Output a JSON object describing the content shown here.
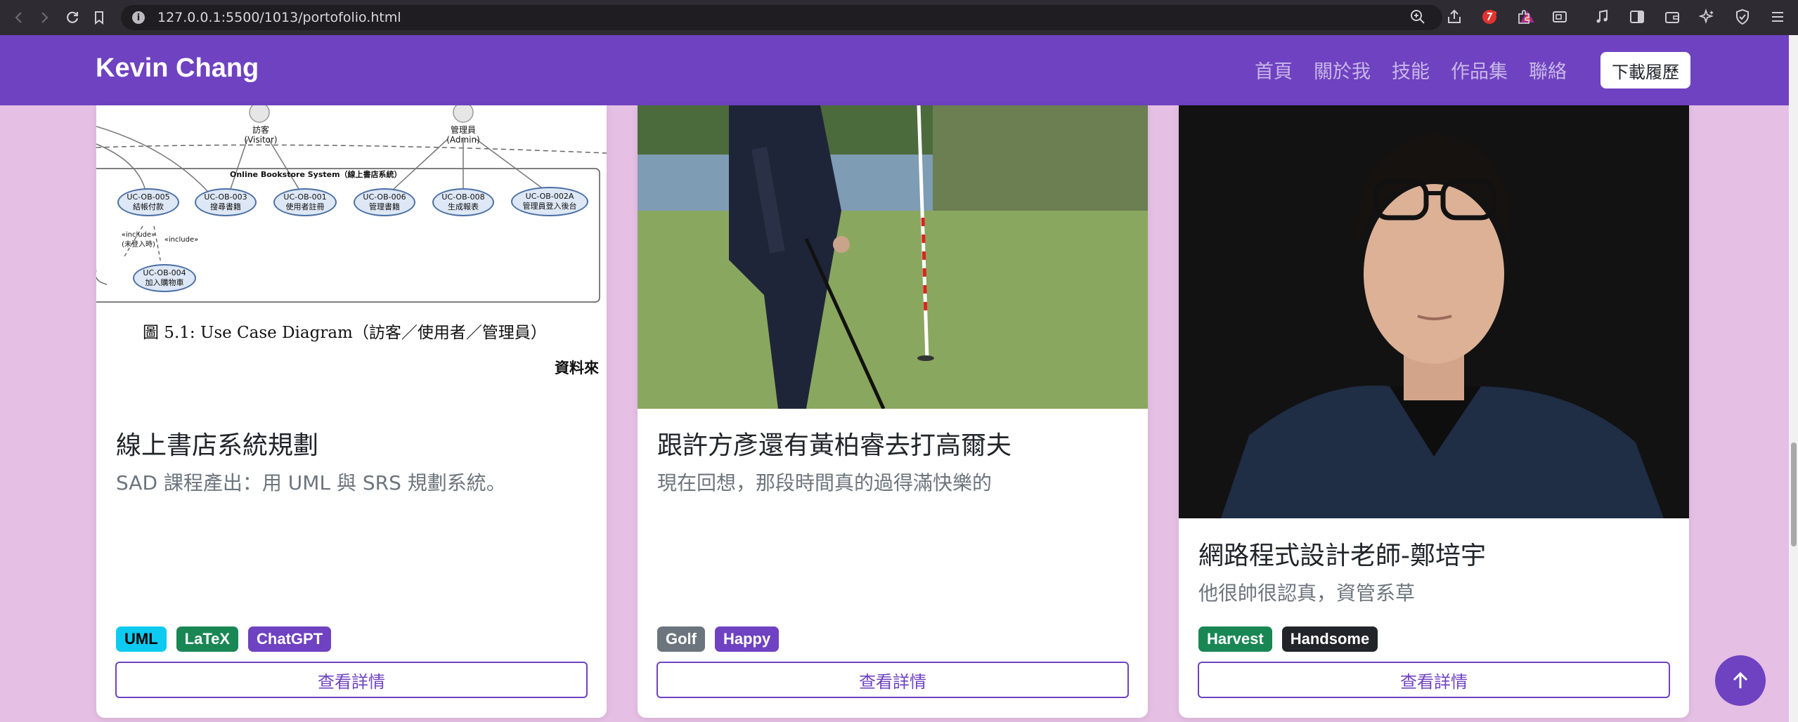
{
  "browser": {
    "url": "127.0.0.1:5500/1013/portofolio.html"
  },
  "navbar": {
    "brand": "Kevin Chang",
    "links": [
      "首頁",
      "關於我",
      "技能",
      "作品集",
      "聯絡"
    ],
    "resume_button": "下載履歷"
  },
  "cards": [
    {
      "title": "線上書店系統規劃",
      "text": "SAD 課程產出：用 UML 與 SRS 規劃系統。",
      "tags": [
        {
          "label": "UML",
          "color": "#0dcaf0",
          "text_color": "#000000"
        },
        {
          "label": "LaTeX",
          "color": "#198754",
          "text_color": "#ffffff"
        },
        {
          "label": "ChatGPT",
          "color": "#6f42c1",
          "text_color": "#ffffff"
        }
      ],
      "button": "查看詳情",
      "diagram": {
        "actors": [
          "訪客\n(Visitor)",
          "管理員\n(Admin)"
        ],
        "system_label": "Online Bookstore System（線上書店系統）",
        "use_cases": [
          "UC-OB-005\n結帳付款",
          "UC-OB-003\n搜尋書籍",
          "UC-OB-001\n使用者註冊",
          "UC-OB-006\n管理書籍",
          "UC-OB-008\n生成報表",
          "UC-OB-002A\n管理員登入後台",
          "UC-OB-004\n加入購物車"
        ],
        "include_labels": [
          "«include»\n(未登入時)",
          "«include»"
        ],
        "caption": "圖 5.1: Use Case Diagram（訪客／使用者／管理員）",
        "source_text": "資料來"
      }
    },
    {
      "title": "跟許方彥還有黃柏睿去打高爾夫",
      "text": "現在回想，那段時間真的過得滿快樂的",
      "tags": [
        {
          "label": "Golf",
          "color": "#6c757d",
          "text_color": "#ffffff"
        },
        {
          "label": "Happy",
          "color": "#6f42c1",
          "text_color": "#ffffff"
        }
      ],
      "button": "查看詳情"
    },
    {
      "title": "網路程式設計老師-鄭培宇",
      "text": "他很帥很認真，資管系草",
      "tags": [
        {
          "label": "Harvest",
          "color": "#198754",
          "text_color": "#ffffff"
        },
        {
          "label": "Handsome",
          "color": "#212529",
          "text_color": "#ffffff"
        }
      ],
      "button": "查看詳情"
    }
  ],
  "scroll_top_icon": "arrow-up-icon"
}
